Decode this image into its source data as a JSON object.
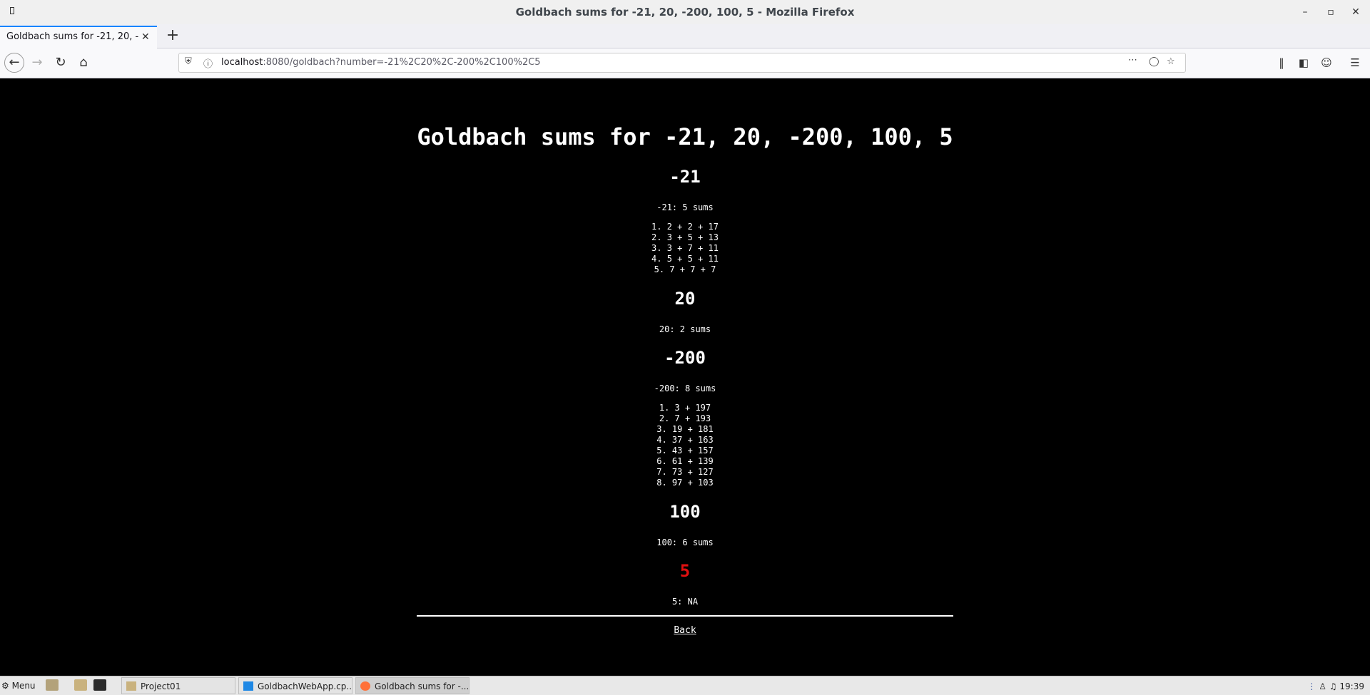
{
  "window": {
    "title": "Goldbach sums for -21, 20, -200, 100, 5 - Mozilla Firefox",
    "minimize_icon": "minimize-icon",
    "maximize_icon": "maximize-icon",
    "close_icon": "close-icon"
  },
  "tabs": [
    {
      "label": "Goldbach sums for -21, 20, -200, 100, 5",
      "active": true
    }
  ],
  "navbar": {
    "url_host": "localhost",
    "url_rest": ":8080/goldbach?number=-21%2C20%2C-200%2C100%2C5"
  },
  "page": {
    "title": "Goldbach sums for -21, 20, -200, 100, 5",
    "sections": [
      {
        "heading": "-21",
        "summary": "-21: 5 sums",
        "sums": [
          "1. 2 + 2 + 17",
          "2. 3 + 5 + 13",
          "3. 3 + 7 + 11",
          "4. 5 + 5 + 11",
          "5. 7 + 7 + 7"
        ]
      },
      {
        "heading": "20",
        "summary": "20: 2 sums",
        "sums": []
      },
      {
        "heading": "-200",
        "summary": "-200: 8 sums",
        "sums": [
          "1. 3 + 197",
          "2. 7 + 193",
          "3. 19 + 181",
          "4. 37 + 163",
          "5. 43 + 157",
          "6. 61 + 139",
          "7. 73 + 127",
          "8. 97 + 103"
        ]
      },
      {
        "heading": "100",
        "summary": "100: 6 sums",
        "sums": []
      },
      {
        "heading": "5",
        "summary": "5: NA",
        "sums": [],
        "heading_color": "#e01010"
      }
    ],
    "back_label": "Back"
  },
  "taskbar": {
    "menu_label": "Menu",
    "tasks": [
      {
        "label": "Project01",
        "icon": "folder-icon",
        "active": false
      },
      {
        "label": "GoldbachWebApp.cp...",
        "icon": "vscode-icon",
        "active": false
      },
      {
        "label": "Goldbach sums for -...",
        "icon": "firefox-icon",
        "active": true
      }
    ],
    "clock": "19:39"
  },
  "colors": {
    "accent": "#0a84ff",
    "page_background": "#000000",
    "page_text": "#ffffff",
    "error_heading": "#e01010"
  }
}
